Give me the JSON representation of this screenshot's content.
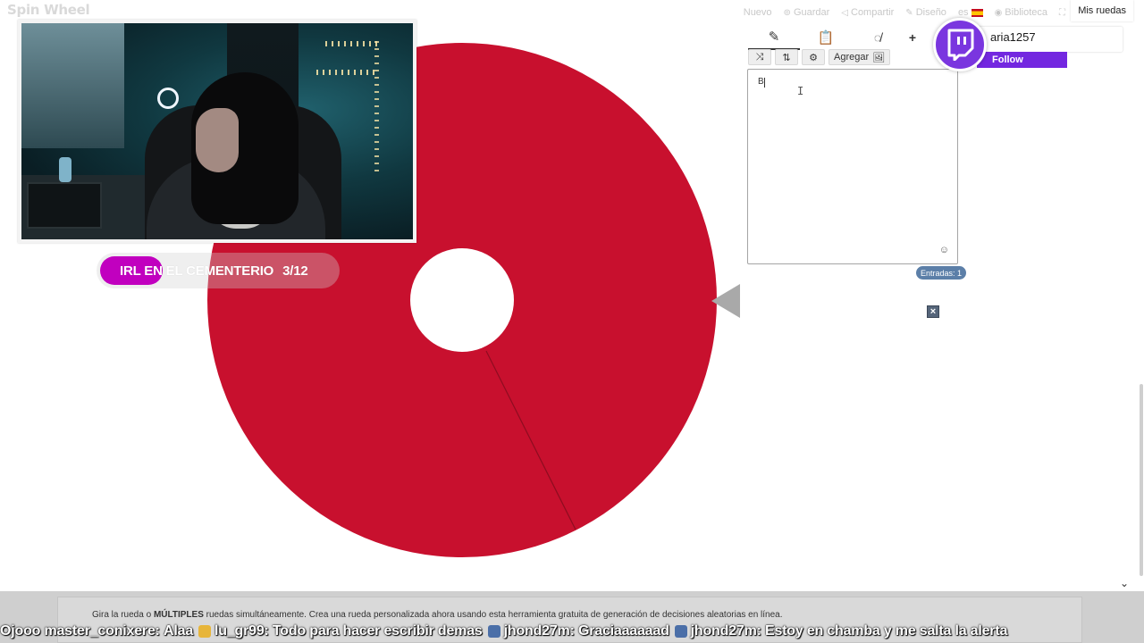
{
  "app": {
    "logo": "Spin Wheel"
  },
  "nav": {
    "items": [
      {
        "label": "Nuevo",
        "icon": ""
      },
      {
        "label": "Guardar",
        "icon": "save-icon"
      },
      {
        "label": "Compartir",
        "icon": "share-icon"
      },
      {
        "label": "Diseño",
        "icon": "brush-icon"
      },
      {
        "label": "es",
        "icon": "flag-es-icon"
      },
      {
        "label": "Biblioteca",
        "icon": "globe-icon"
      },
      {
        "label": "",
        "icon": "fullscreen-icon"
      }
    ],
    "my_wheels": "Mis ruedas"
  },
  "wheel": {
    "color": "#c8102e",
    "hub_color": "#ffffff"
  },
  "stream_overlay": {
    "title": "IRL EN EL CEMENTERIO",
    "count": "3/12",
    "accent": "#c100bf"
  },
  "editor": {
    "tabs": [
      {
        "icon": "pencil-icon",
        "active": true
      },
      {
        "icon": "clipboard-icon",
        "active": false
      },
      {
        "icon": "eye-slash-icon",
        "active": false
      },
      {
        "icon": "plus-icon",
        "label": "+",
        "active": false
      }
    ],
    "toolbar": {
      "shuffle_icon": "⤨",
      "sort_icon": "⇅",
      "settings_icon": "⚙",
      "add_label": "Agregar"
    },
    "entry_value": "B",
    "entries_count": "Entradas: 1",
    "close_label": "×"
  },
  "twitch": {
    "username": "aria1257",
    "follow_label": "Follow",
    "brand_color": "#7327e0"
  },
  "footer": {
    "desc_pre": "Gira la rueda o ",
    "desc_bold": "MÚLTIPLES",
    "desc_post": " ruedas simultáneamente. Crea una rueda personalizada ahora usando esta herramienta gratuita de generación de decisiones aleatorias en línea."
  },
  "chat": [
    {
      "user": "Ojooo master_conixere",
      "text": "Alaa",
      "icon_color": ""
    },
    {
      "user": "lu_gr99",
      "text": "Todo para hacer escribir demas",
      "icon_color": "#e7b53a"
    },
    {
      "user": "jhond27m",
      "text": "Graciaaaaaad",
      "icon_color": "#4b6fa8"
    },
    {
      "user": "jhond27m",
      "text": "Estoy en chamba y me salta la alerta",
      "icon_color": "#4b6fa8"
    }
  ]
}
